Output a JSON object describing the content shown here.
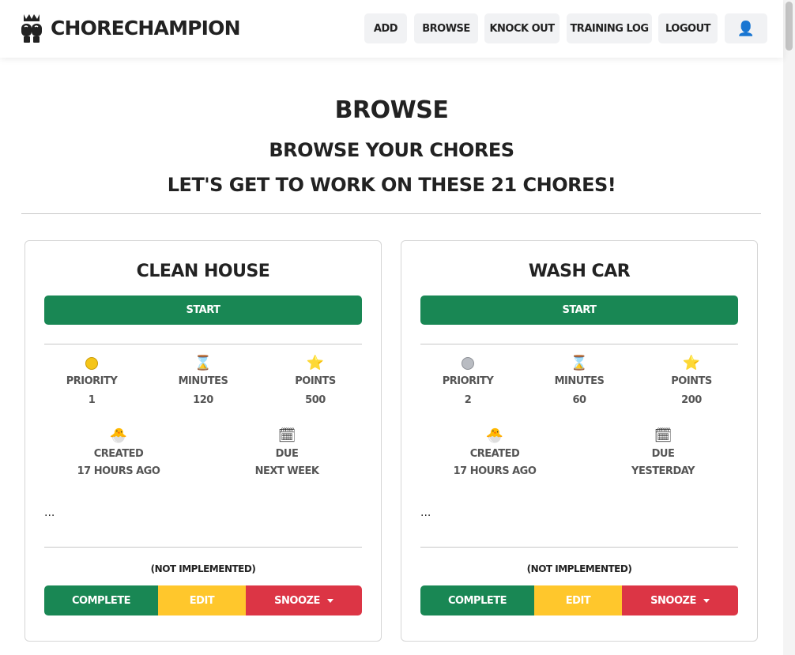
{
  "app": {
    "brand_name": "CHORECHAMPION",
    "logo_icon": "boxing-gloves-icon"
  },
  "nav": {
    "items": [
      {
        "label": "ADD"
      },
      {
        "label": "BROWSE"
      },
      {
        "label": "KNOCK OUT"
      },
      {
        "label": "TRAINING LOG"
      },
      {
        "label": "LOGOUT"
      }
    ],
    "user_icon": "👤"
  },
  "page": {
    "title": "BROWSE",
    "subtitle": "BROWSE YOUR CHORES",
    "tagline": "LET'S GET TO WORK ON THESE 21 CHORES!"
  },
  "colors": {
    "success": "#198754",
    "warning": "#ffc72c",
    "danger": "#dc3545",
    "nav_button_bg": "#f1f2f4"
  },
  "cards": [
    {
      "title": "CLEAN HOUSE",
      "start_label": "START",
      "stats": [
        {
          "icon": "gold-medal-icon",
          "glyph": "1",
          "label": "PRIORITY",
          "value": "1"
        },
        {
          "icon": "hourglass-icon",
          "glyph": "⌛",
          "label": "MINUTES",
          "value": "120"
        },
        {
          "icon": "star-icon",
          "glyph": "⭐",
          "label": "POINTS",
          "value": "500"
        }
      ],
      "dates": [
        {
          "icon": "hatching-chick-icon",
          "glyph": "🐣",
          "label": "CREATED",
          "value": "17 HOURS AGO"
        },
        {
          "icon": "calendar-icon",
          "glyph": "🗓",
          "label": "DUE",
          "value": "NEXT WEEK"
        }
      ],
      "description": "...",
      "not_implemented": "(NOT IMPLEMENTED)",
      "complete_label": "COMPLETE",
      "edit_label": "EDIT",
      "snooze_label": "SNOOZE"
    },
    {
      "title": "WASH CAR",
      "start_label": "START",
      "stats": [
        {
          "icon": "silver-medal-icon",
          "glyph": "2",
          "label": "PRIORITY",
          "value": "2"
        },
        {
          "icon": "hourglass-icon",
          "glyph": "⌛",
          "label": "MINUTES",
          "value": "60"
        },
        {
          "icon": "star-icon",
          "glyph": "⭐",
          "label": "POINTS",
          "value": "200"
        }
      ],
      "dates": [
        {
          "icon": "hatching-chick-icon",
          "glyph": "🐣",
          "label": "CREATED",
          "value": "17 HOURS AGO"
        },
        {
          "icon": "calendar-icon",
          "glyph": "🗓",
          "label": "DUE",
          "value": "YESTERDAY"
        }
      ],
      "description": "...",
      "not_implemented": "(NOT IMPLEMENTED)",
      "complete_label": "COMPLETE",
      "edit_label": "EDIT",
      "snooze_label": "SNOOZE"
    }
  ]
}
